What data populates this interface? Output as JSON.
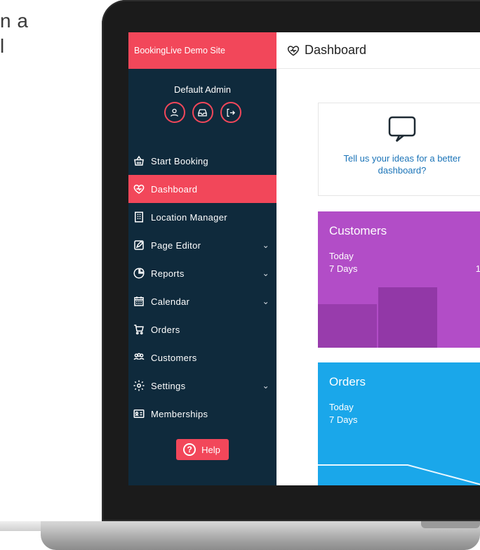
{
  "background": {
    "text_lines": [
      "n a",
      "l"
    ]
  },
  "sidebar": {
    "brand": "BookingLive Demo Site",
    "user": {
      "name": "Default Admin"
    },
    "nav": [
      {
        "label": "Start Booking",
        "icon": "basket-icon",
        "active": false,
        "has_chevron": false
      },
      {
        "label": "Dashboard",
        "icon": "heart-pulse-icon",
        "active": true,
        "has_chevron": false
      },
      {
        "label": "Location Manager",
        "icon": "building-icon",
        "active": false,
        "has_chevron": false
      },
      {
        "label": "Page Editor",
        "icon": "edit-icon",
        "active": false,
        "has_chevron": true
      },
      {
        "label": "Reports",
        "icon": "pie-chart-icon",
        "active": false,
        "has_chevron": true
      },
      {
        "label": "Calendar",
        "icon": "calendar-icon",
        "active": false,
        "has_chevron": true
      },
      {
        "label": "Orders",
        "icon": "cart-icon",
        "active": false,
        "has_chevron": false
      },
      {
        "label": "Customers",
        "icon": "users-icon",
        "active": false,
        "has_chevron": false
      },
      {
        "label": "Settings",
        "icon": "gear-icon",
        "active": false,
        "has_chevron": true
      },
      {
        "label": "Memberships",
        "icon": "id-card-icon",
        "active": false,
        "has_chevron": false
      }
    ],
    "help_label": "Help"
  },
  "main": {
    "title": "Dashboard",
    "feedback": {
      "text": "Tell us your ideas for a better dashboard?"
    },
    "customers": {
      "title": "Customers",
      "today_label": "Today",
      "seven_days_label": "7 Days",
      "seven_days_value_visible": "1"
    },
    "orders": {
      "title": "Orders",
      "today_label": "Today",
      "seven_days_label": "7 Days"
    }
  },
  "colors": {
    "brand_red": "#f2475a",
    "sidebar_bg": "#0f2a3c",
    "customers_card": "#b24dc7",
    "orders_card": "#1aa7ea",
    "link_blue": "#1b74b8"
  }
}
